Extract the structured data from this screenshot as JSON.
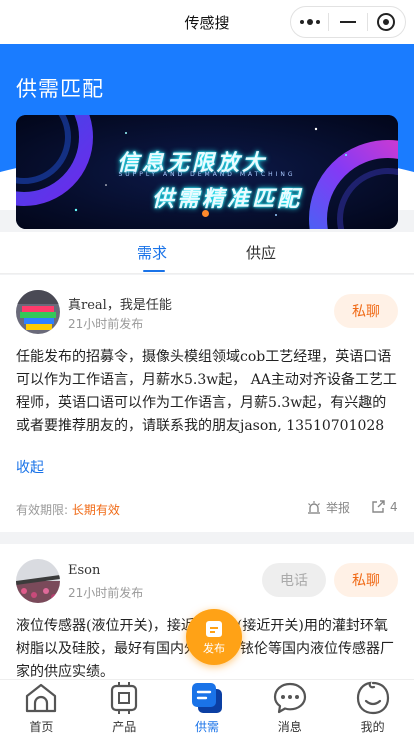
{
  "navbar": {
    "title": "传感搜"
  },
  "header": {
    "title": "供需匹配"
  },
  "banner": {
    "line1": "信息无限放大",
    "subline": "SUPPLY AND DEMAND MATCHING",
    "line2": "供需精准匹配"
  },
  "tabs": [
    {
      "label": "需求",
      "active": true
    },
    {
      "label": "供应",
      "active": false
    }
  ],
  "posts": [
    {
      "user": "真real，我是任能",
      "time": "21小时前发布",
      "actions": [
        "私聊"
      ],
      "content": "任能发布的招募令，摄像头模组领域cob工艺经理，英语口语可以作为工作语言，月薪水5.3w起， AA主动对齐设备工艺工程师，英语口语可以作为工作语言，月薪5.3w起，有兴趣的或者要推荐朋友的，请联系我的朋友jason, 13510701028",
      "fold_label": "收起",
      "validity_label": "有效期限:",
      "validity_value": "长期有效",
      "report_label": "举报",
      "share_count": "4"
    },
    {
      "user": "Eson",
      "time": "21小时前发布",
      "actions": [
        "电话",
        "私聊"
      ],
      "content": "液位传感器(液位开关)，接近传感器(接近开关)用的灌封环氧树脂以及硅胶，最好有国内外大厂，铱伦等国内液位传感器厂家的供应实绩。"
    }
  ],
  "fab": {
    "label": "发布"
  },
  "tabbar": [
    {
      "label": "首页",
      "icon": "home-icon"
    },
    {
      "label": "产品",
      "icon": "chip-icon"
    },
    {
      "label": "供需",
      "icon": "supply-demand-icon",
      "active": true
    },
    {
      "label": "消息",
      "icon": "message-icon"
    },
    {
      "label": "我的",
      "icon": "profile-icon"
    }
  ],
  "colors": {
    "primary": "#1a73e8",
    "header_blue": "#1a7cff",
    "accent_orange": "#f06a16",
    "fab_orange": "#ffa216"
  }
}
